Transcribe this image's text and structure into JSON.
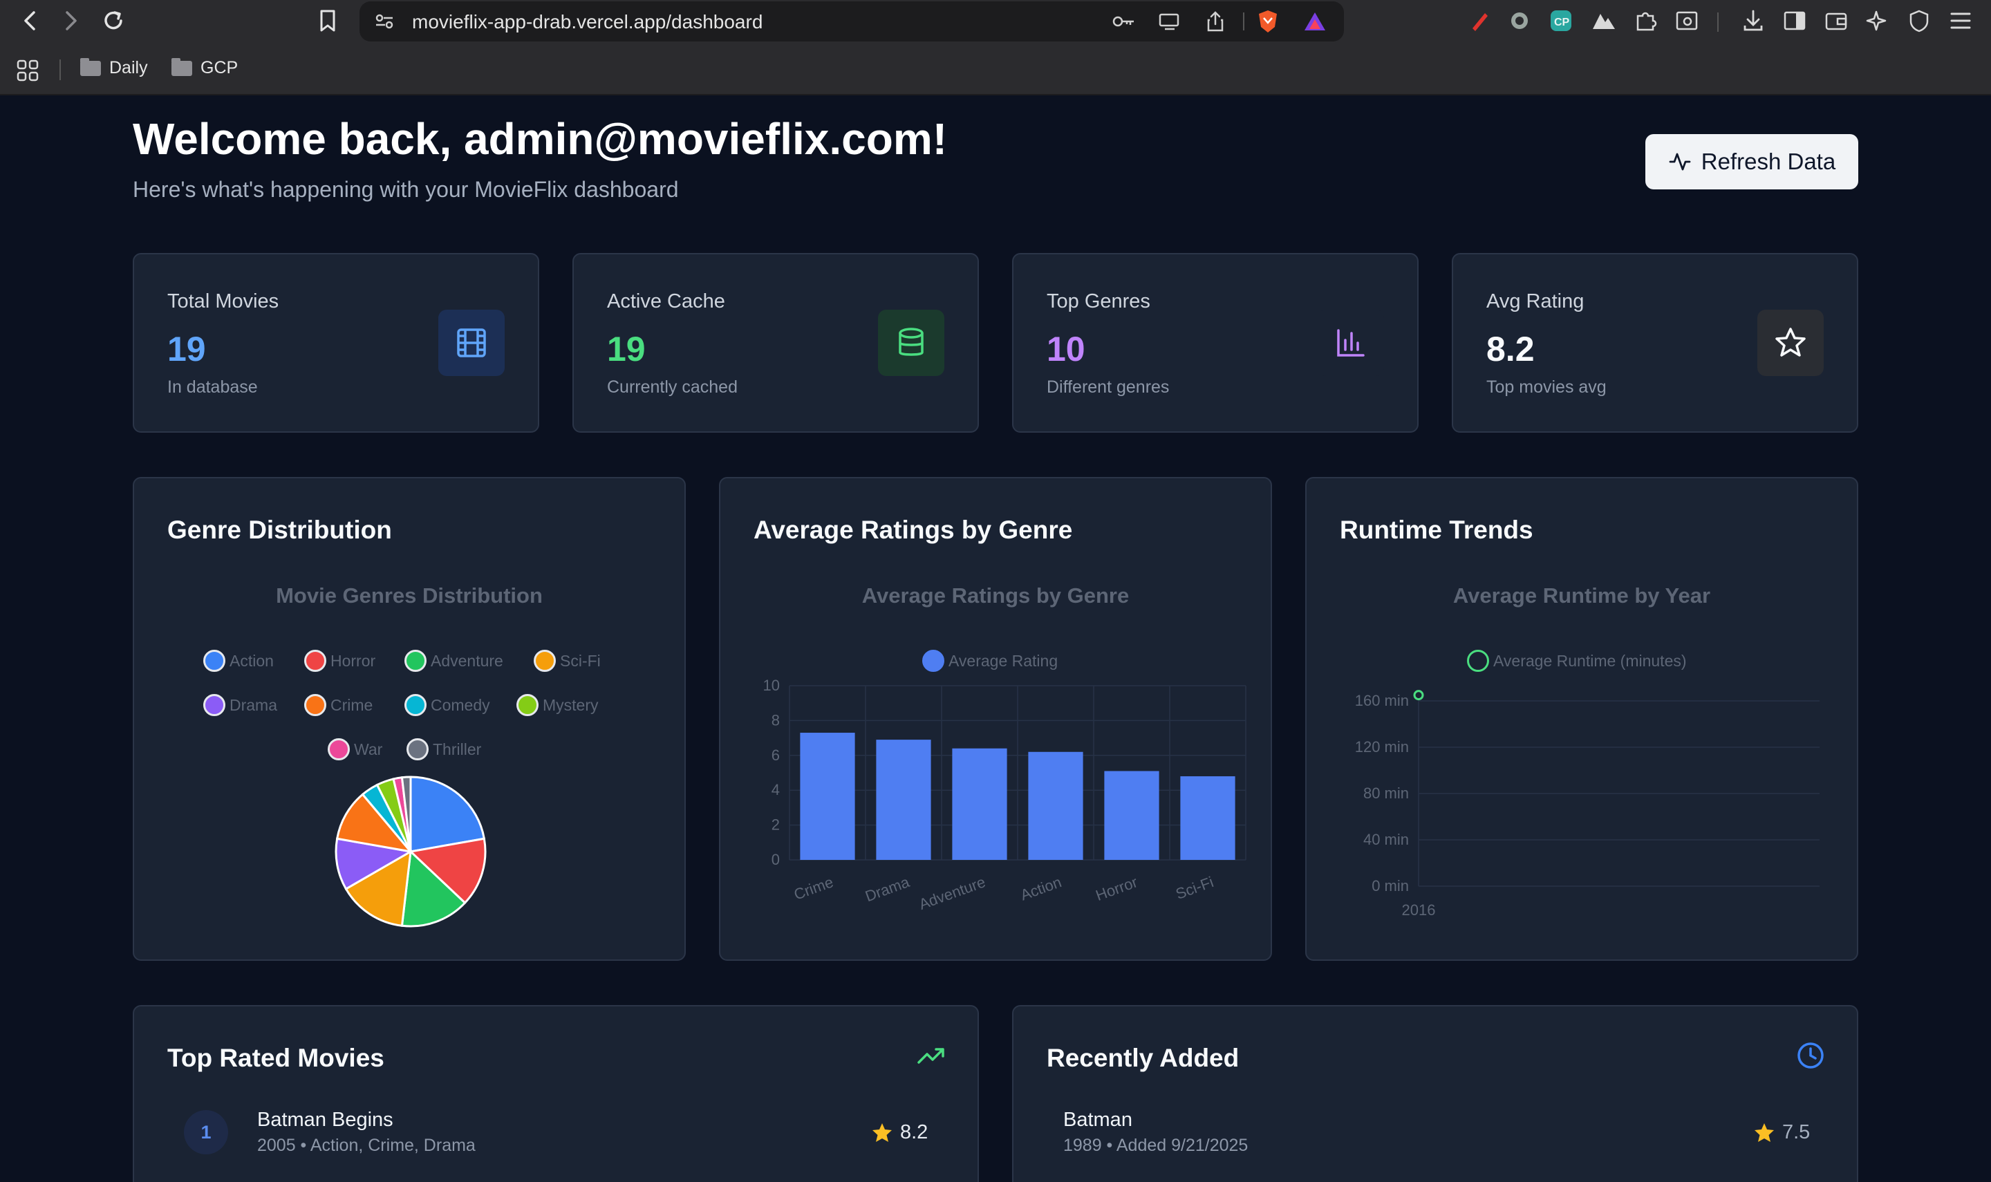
{
  "browser": {
    "url": "movieflix-app-drab.vercel.app/dashboard",
    "bookmarks": [
      "Daily",
      "GCP"
    ]
  },
  "header": {
    "title": "Welcome back, admin@movieflix.com!",
    "subtitle": "Here's what's happening with your MovieFlix dashboard",
    "refresh_label": "Refresh Data"
  },
  "stats": [
    {
      "label": "Total Movies",
      "value": "19",
      "sub": "In database",
      "color": "#60a5fa",
      "icon": "film-icon"
    },
    {
      "label": "Active Cache",
      "value": "19",
      "sub": "Currently cached",
      "color": "#4ade80",
      "icon": "database-icon"
    },
    {
      "label": "Top Genres",
      "value": "10",
      "sub": "Different genres",
      "color": "#c084fc",
      "icon": "bar-chart-icon"
    },
    {
      "label": "Avg Rating",
      "value": "8.2",
      "sub": "Top movies avg",
      "color": "#f8fafc",
      "icon": "star-icon"
    }
  ],
  "panels": {
    "genre": {
      "title": "Genre Distribution"
    },
    "ratings": {
      "title": "Average Ratings by Genre"
    },
    "runtime": {
      "title": "Runtime Trends"
    }
  },
  "chart_data": [
    {
      "type": "pie",
      "title": "Movie Genres Distribution",
      "legend_position": "top",
      "categories": [
        "Action",
        "Horror",
        "Adventure",
        "Sci-Fi",
        "Drama",
        "Crime",
        "Comedy",
        "Mystery",
        "War",
        "Thriller"
      ],
      "values": [
        6,
        4,
        4,
        4,
        3,
        3,
        1,
        1,
        0.5,
        0.5
      ],
      "colors": [
        "#3b82f6",
        "#ef4444",
        "#22c55e",
        "#f59e0b",
        "#8b5cf6",
        "#f97316",
        "#06b6d4",
        "#84cc16",
        "#ec4899",
        "#6b7280"
      ]
    },
    {
      "type": "bar",
      "title": "Average Ratings by Genre",
      "legend_position": "top",
      "categories": [
        "Crime",
        "Drama",
        "Adventure",
        "Action",
        "Horror",
        "Sci-Fi"
      ],
      "series": [
        {
          "name": "Average Rating",
          "values": [
            7.3,
            6.9,
            6.4,
            6.2,
            5.1,
            4.8
          ],
          "color": "#4f7ef2"
        }
      ],
      "ylim": [
        0,
        10
      ],
      "yticks": [
        "10",
        "8",
        "6",
        "4",
        "2",
        "0"
      ]
    },
    {
      "type": "line",
      "title": "Average Runtime by Year",
      "legend_position": "top",
      "x": [
        "2016"
      ],
      "series": [
        {
          "name": "Average Runtime (minutes)",
          "values": [
            165
          ],
          "color": "#4ade80"
        }
      ],
      "ylim": [
        0,
        160
      ],
      "yticks": [
        "160 min",
        "120 min",
        "80 min",
        "40 min",
        "0 min"
      ]
    }
  ],
  "top_rated": {
    "title": "Top Rated Movies",
    "items": [
      {
        "rank": "1",
        "title": "Batman Begins",
        "meta": "2005 • Action, Crime, Drama",
        "rating": "8.2"
      }
    ]
  },
  "recent": {
    "title": "Recently Added",
    "items": [
      {
        "title": "Batman",
        "meta": "1989 • Added 9/21/2025",
        "rating": "7.5"
      }
    ]
  }
}
